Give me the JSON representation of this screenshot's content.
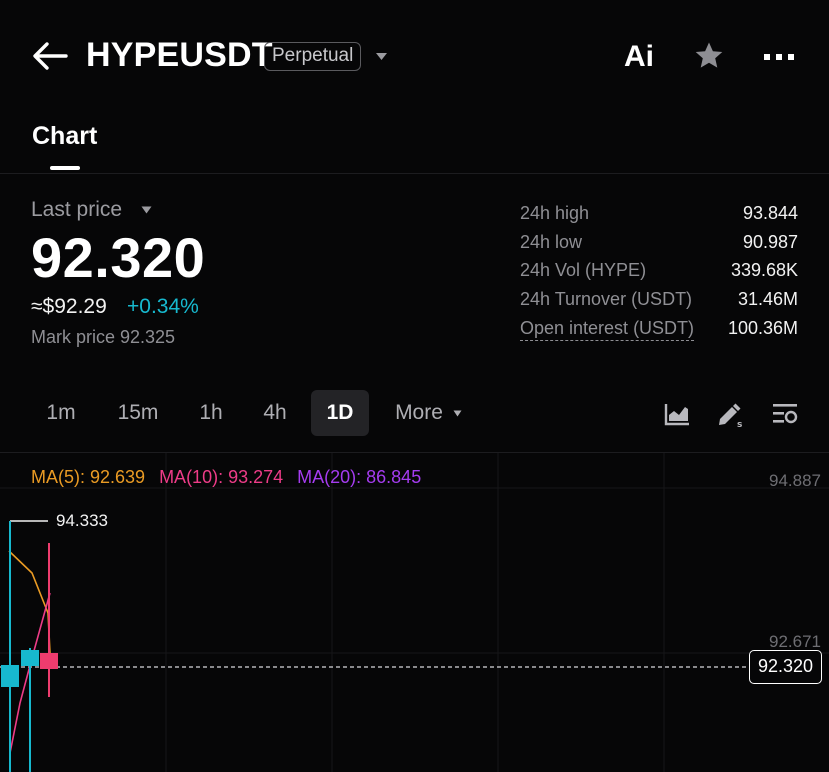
{
  "header": {
    "symbol": "HYPEUSDT",
    "contract_type": "Perpetual",
    "ai_label": "Ai"
  },
  "tabs": [
    {
      "label": "Chart",
      "active": true
    }
  ],
  "price": {
    "last_price_label": "Last price",
    "last_price": "92.320",
    "fiat": "≈$92.29",
    "change": "+0.34%",
    "mark_price": "Mark price 92.325"
  },
  "stats": [
    {
      "label": "24h high",
      "value": "93.844"
    },
    {
      "label": "24h low",
      "value": "90.987"
    },
    {
      "label": "24h Vol (HYPE)",
      "value": "339.68K"
    },
    {
      "label": "24h Turnover (USDT)",
      "value": "31.46M"
    },
    {
      "label": "Open interest (USDT)",
      "value": "100.36M"
    }
  ],
  "intervals": [
    {
      "label": "1m",
      "active": false
    },
    {
      "label": "15m",
      "active": false
    },
    {
      "label": "1h",
      "active": false
    },
    {
      "label": "4h",
      "active": false
    },
    {
      "label": "1D",
      "active": true
    },
    {
      "label": "More",
      "active": false
    }
  ],
  "chart": {
    "ma5": "MA(5): 92.639",
    "ma10": "MA(10): 93.274",
    "ma20": "MA(20): 86.845",
    "axis_top": "94.887",
    "axis_mid": "92.671",
    "current_price": "92.320",
    "high_marker": "94.333"
  },
  "colors": {
    "up": "#17b9cf",
    "down": "#ee3c6e",
    "ma5": "#ea9b24",
    "ma10": "#ee3c88",
    "ma20": "#a53cf0"
  }
}
